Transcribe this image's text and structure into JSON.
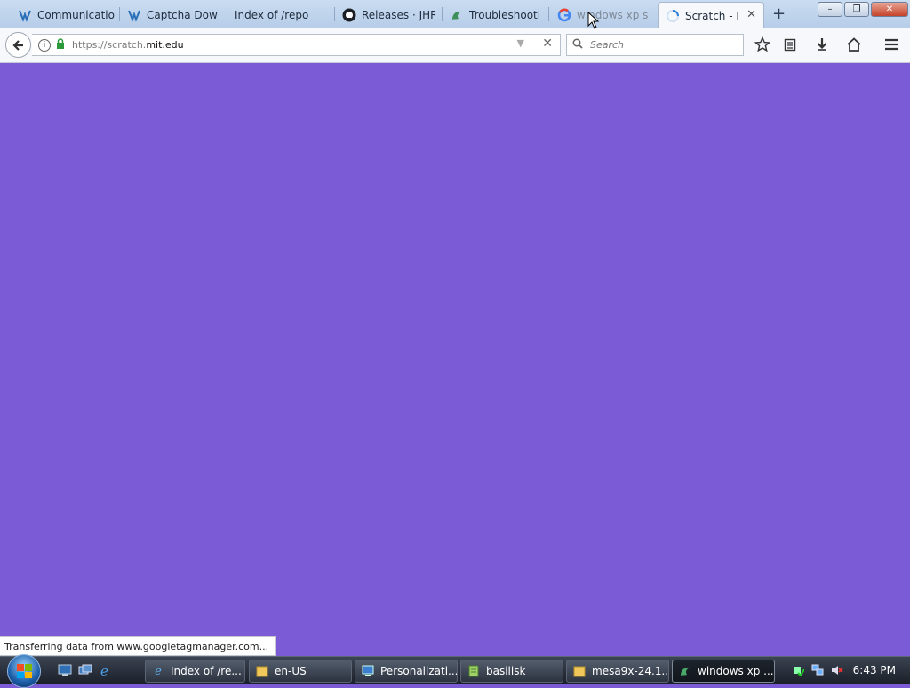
{
  "browser": {
    "tabs": [
      {
        "label": "Communicatio",
        "icon": "webmin-icon"
      },
      {
        "label": "Captcha Dow",
        "icon": "webmin-icon"
      },
      {
        "label": "Index of /repo",
        "icon": "none"
      },
      {
        "label": "Releases · JHRo",
        "icon": "github-icon"
      },
      {
        "label": "Troubleshooti",
        "icon": "basilisk-icon"
      },
      {
        "label": "windows xp sp",
        "icon": "google-icon"
      },
      {
        "label": "Scratch - I",
        "icon": "loading-icon",
        "active": true
      }
    ],
    "new_tab_label": "+",
    "window_buttons": {
      "minimize": "–",
      "maximize": "❐",
      "close": "✕"
    }
  },
  "navbar": {
    "url_prefix": "https://scratch.",
    "url_domain": "mit.edu",
    "search_placeholder": "Search"
  },
  "page": {
    "background_color": "#7b5bd6"
  },
  "status": {
    "text": "Transferring data from www.googletagmanager.com..."
  },
  "taskbar": {
    "tasks": [
      {
        "label": "Index of /re...",
        "icon": "ie-icon"
      },
      {
        "label": "en-US",
        "icon": "folder-icon"
      },
      {
        "label": "Personalizati...",
        "icon": "display-icon"
      },
      {
        "label": "basilisk",
        "icon": "notepad-icon"
      },
      {
        "label": "mesa9x-24.1...",
        "icon": "folder-icon"
      },
      {
        "label": "windows xp ...",
        "icon": "basilisk-icon",
        "active": true
      }
    ],
    "clock": "6:43 PM"
  }
}
